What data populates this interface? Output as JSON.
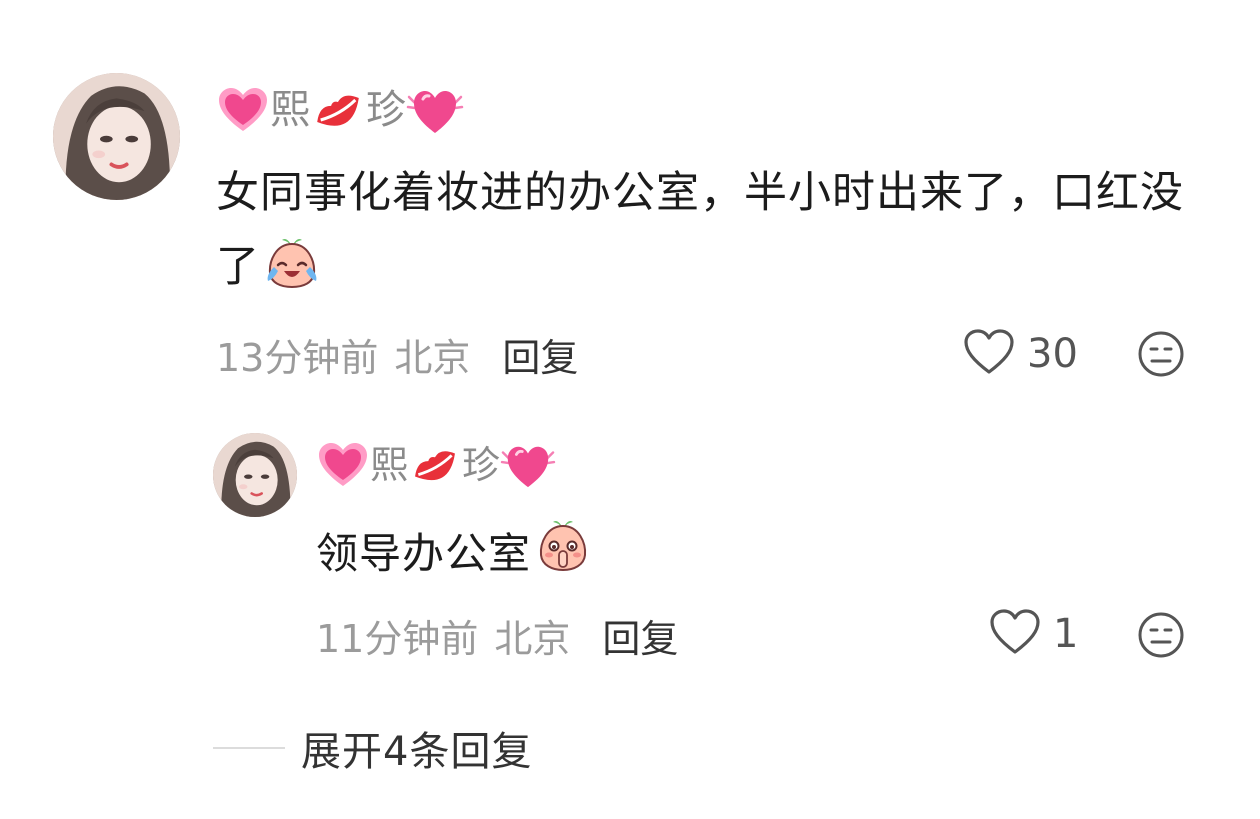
{
  "comments": [
    {
      "user": {
        "name_parts": [
          "熙",
          "珍"
        ],
        "name_emojis": [
          "pink-heart-emoji",
          "red-lips-emoji",
          "pink-heart-emoji"
        ]
      },
      "text": "女同事化着妆进的办公室，半小时出来了，口红没了",
      "text_emoji": "crying-laughing-peach-emoji",
      "time": "13分钟前",
      "location": "北京",
      "reply_label": "回复",
      "like_count": "30",
      "like_icon": "heart-outline-icon",
      "dislike_icon": "meh-face-icon"
    },
    {
      "user": {
        "name_parts": [
          "熙",
          "珍"
        ],
        "name_emojis": [
          "pink-heart-emoji",
          "red-lips-emoji",
          "pink-heart-emoji"
        ]
      },
      "text": "领导办公室",
      "text_emoji": "shush-peach-emoji",
      "time": "11分钟前",
      "location": "北京",
      "reply_label": "回复",
      "like_count": "1",
      "like_icon": "heart-outline-icon",
      "dislike_icon": "meh-face-icon"
    }
  ],
  "expand_replies_label": "展开4条回复",
  "colors": {
    "meta_gray": "#9b9b9b",
    "text_dark": "#1c1c1c",
    "heart_pink": "#f25a9a",
    "lips_red": "#e8303a"
  }
}
